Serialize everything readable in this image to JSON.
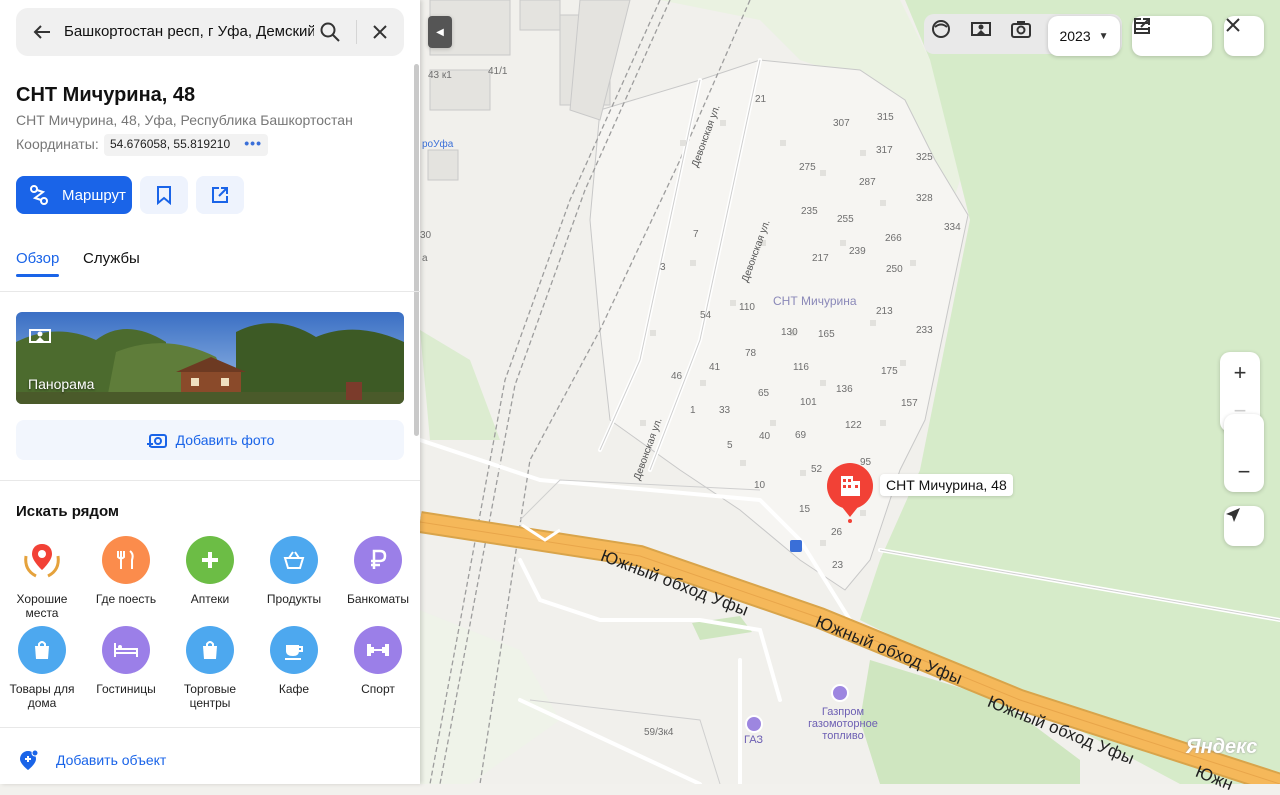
{
  "search": {
    "value": "Башкортостан респ, г Уфа, Демский"
  },
  "place": {
    "title": "СНТ Мичурина, 48",
    "address": "СНТ Мичурина, 48, Уфа, Республика Башкортостан",
    "coords_label": "Координаты:",
    "coords_value": "54.676058, 55.819210"
  },
  "actions": {
    "route_label": "Маршрут",
    "bookmark_icon": "bookmark-icon",
    "share_icon": "share-icon"
  },
  "tabs": [
    {
      "label": "Обзор",
      "active": true
    },
    {
      "label": "Службы",
      "active": false
    }
  ],
  "panorama_label": "Панорама",
  "add_photo_label": "Добавить фото",
  "nearby": {
    "title": "Искать рядом",
    "categories": [
      {
        "label": "Хорошие места",
        "color": "#ffffff",
        "icon": "pin-laurel-icon"
      },
      {
        "label": "Где поесть",
        "color": "#fb8c4c",
        "icon": "fork-knife-icon"
      },
      {
        "label": "Аптеки",
        "color": "#6cbd45",
        "icon": "plus-icon"
      },
      {
        "label": "Продукты",
        "color": "#4da8ef",
        "icon": "basket-icon"
      },
      {
        "label": "Банкоматы",
        "color": "#9b7fe8",
        "icon": "ruble-icon"
      },
      {
        "label": "Товары для дома",
        "color": "#4da8ef",
        "icon": "bag-icon"
      },
      {
        "label": "Гостиницы",
        "color": "#9b7fe8",
        "icon": "bed-icon"
      },
      {
        "label": "Торговые центры",
        "color": "#4da8ef",
        "icon": "bag-icon"
      },
      {
        "label": "Кафе",
        "color": "#4da8ef",
        "icon": "cup-icon"
      },
      {
        "label": "Спорт",
        "color": "#9b7fe8",
        "icon": "dumbbell-icon"
      }
    ]
  },
  "add_object_label": "Добавить объект",
  "map": {
    "year": "2023",
    "marker_label": "СНТ Мичурина, 48",
    "area_label": "СНТ Мичурина",
    "road_label": "Южный обход Уфы",
    "street_label": "Девонская ул.",
    "gas_label": "Газпром газомоторное топливо",
    "gas2_label": "ГАЗ",
    "ufa_label": "роУфа",
    "building_label": "59/3к4",
    "house_label": "43 к1",
    "house_label2": "41/1",
    "watermark": "Яндекс",
    "house_numbers": [
      "21",
      "307",
      "315",
      "317",
      "325",
      "275",
      "287",
      "328",
      "235",
      "255",
      "266",
      "334",
      "7",
      "239",
      "217",
      "250",
      "3",
      "110",
      "213",
      "54",
      "130",
      "165",
      "233",
      "78",
      "116",
      "175",
      "46",
      "41",
      "136",
      "65",
      "101",
      "157",
      "1",
      "33",
      "122",
      "40",
      "69",
      "5",
      "95",
      "52",
      "10",
      "15",
      "26",
      "23",
      "30",
      "а"
    ]
  },
  "colors": {
    "accent": "#1a64e8",
    "marker": "#f24136",
    "road": "#f5b85a"
  }
}
